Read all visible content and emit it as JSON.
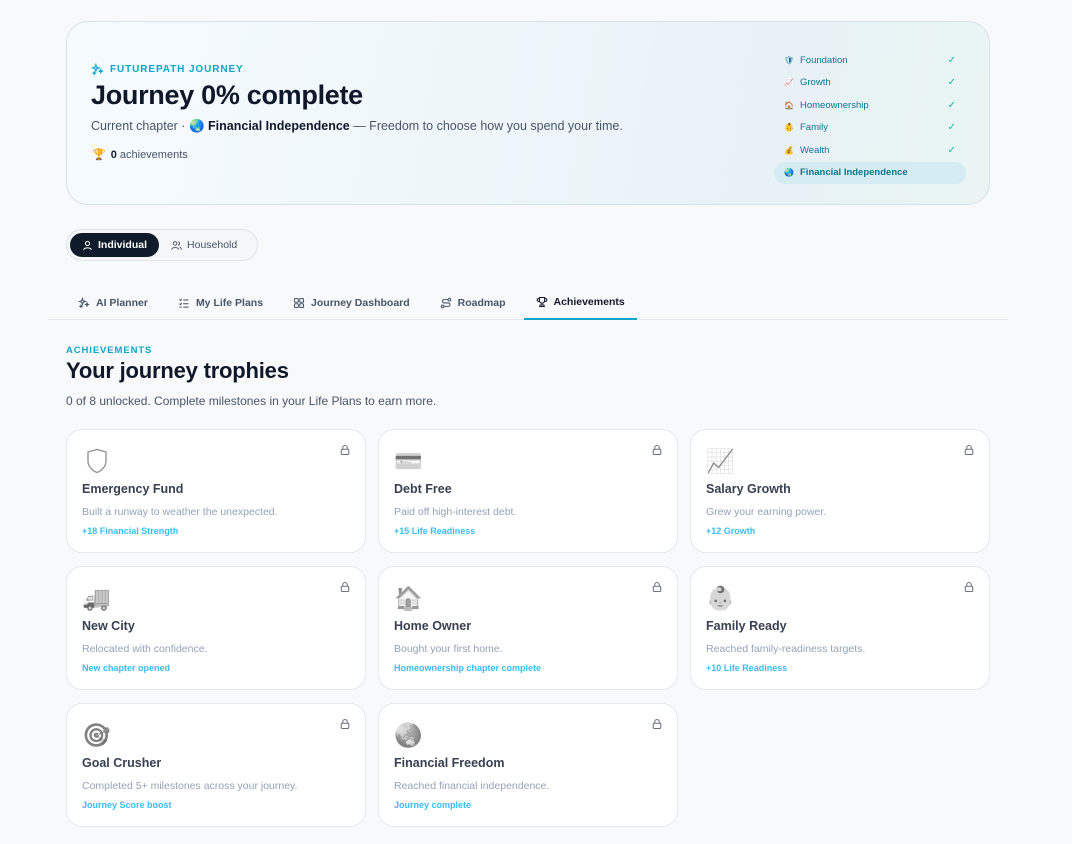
{
  "hero": {
    "eyebrow": "FUTUREPATH JOURNEY",
    "title": "Journey 0% complete",
    "chapter_prefix": "Current chapter · ",
    "chapter_emoji": "🌏",
    "chapter_name": "Financial Independence",
    "chapter_desc": " — Freedom to choose how you spend your time.",
    "achievements_icon": "🏆",
    "achievements_count": "0",
    "achievements_label": " achievements",
    "chapters": [
      {
        "icon": "🛡",
        "name": "Foundation",
        "check": "✓"
      },
      {
        "icon": "📈",
        "name": "Growth",
        "check": "✓"
      },
      {
        "icon": "🏠",
        "name": "Homeownership",
        "check": "✓"
      },
      {
        "icon": "👶",
        "name": "Family",
        "check": "✓"
      },
      {
        "icon": "💰",
        "name": "Wealth",
        "check": "✓"
      },
      {
        "icon": "🌏",
        "name": "Financial Independence",
        "check": ""
      }
    ]
  },
  "mode": {
    "individual": "Individual",
    "household": "Household"
  },
  "tabs": [
    {
      "label": "AI Planner",
      "icon": "sparkles-icon"
    },
    {
      "label": "My Life Plans",
      "icon": "list-checks-icon"
    },
    {
      "label": "Journey Dashboard",
      "icon": "grid-icon"
    },
    {
      "label": "Roadmap",
      "icon": "route-icon"
    },
    {
      "label": "Achievements",
      "icon": "trophy-icon"
    }
  ],
  "section": {
    "label": "ACHIEVEMENTS",
    "title": "Your journey trophies",
    "subtitle": "0 of 8 unlocked. Complete milestones in your Life Plans to earn more."
  },
  "cards": [
    {
      "emoji": "🛡",
      "title": "Emergency Fund",
      "desc": "Built a runway to weather the unexpected.",
      "reward": "+18 Financial Strength"
    },
    {
      "emoji": "💳",
      "title": "Debt Free",
      "desc": "Paid off high-interest debt.",
      "reward": "+15 Life Readiness"
    },
    {
      "emoji": "📈",
      "title": "Salary Growth",
      "desc": "Grew your earning power.",
      "reward": "+12 Growth"
    },
    {
      "emoji": "🚚",
      "title": "New City",
      "desc": "Relocated with confidence.",
      "reward": "New chapter opened"
    },
    {
      "emoji": "🏠",
      "title": "Home Owner",
      "desc": "Bought your first home.",
      "reward": "Homeownership chapter complete"
    },
    {
      "emoji": "👶",
      "title": "Family Ready",
      "desc": "Reached family-readiness targets.",
      "reward": "+10 Life Readiness"
    },
    {
      "emoji": "🎯",
      "title": "Goal Crusher",
      "desc": "Completed 5+ milestones across your journey.",
      "reward": "Journey Score boost"
    },
    {
      "emoji": "🌏",
      "title": "Financial Freedom",
      "desc": "Reached financial independence.",
      "reward": "Journey complete"
    }
  ],
  "colors": {
    "accent": "#0ea5c9",
    "reward": "#38bdf8",
    "dark": "#0f1b2a"
  }
}
